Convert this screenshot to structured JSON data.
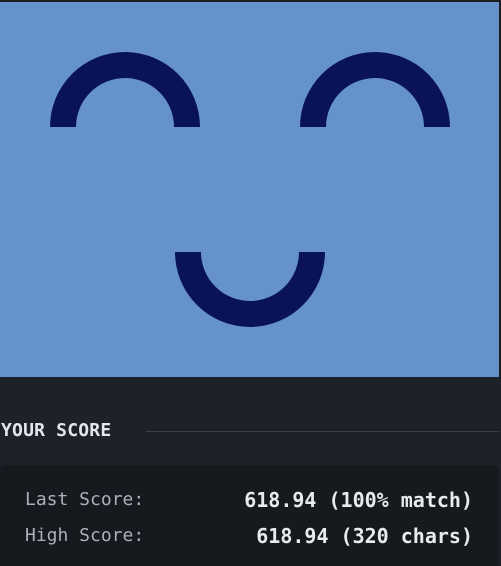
{
  "canvas": {
    "background_color": "#6592cc",
    "stroke_color": "#0a1258",
    "shapes": [
      "left-eye-arc",
      "right-eye-arc",
      "smile-arc"
    ]
  },
  "score_section": {
    "title": "YOUR SCORE",
    "last_score_label": "Last Score:",
    "last_score_value": "618.94 (100% match)",
    "high_score_label": "High Score:",
    "high_score_value": "618.94 (320 chars)"
  },
  "colors": {
    "panel_background": "#1d2128",
    "card_background": "#16191e",
    "label_text": "#a9b0bc",
    "value_text": "#e8eaf0"
  }
}
